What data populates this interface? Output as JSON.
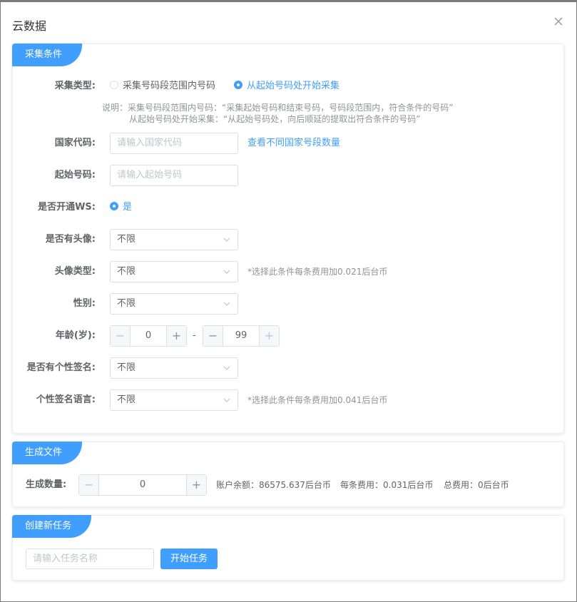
{
  "dialog": {
    "title": "云数据"
  },
  "sections": {
    "collect": {
      "tab": "采集条件"
    },
    "file": {
      "tab": "生成文件"
    },
    "task": {
      "tab": "创建新任务"
    }
  },
  "collect": {
    "type_label": "采集类型:",
    "type_options": [
      "采集号码段范围内号码",
      "从起始号码处开始采集"
    ],
    "type_selected_index": 1,
    "note_line1": "说明：采集号码段范围内号码：“采集起始号码和结束号码，号码段范围内，符合条件的号码”",
    "note_line2": "从起始号码处开始采集：“从起始号码处，向后顺延的提取出符合条件的号码”",
    "country_label": "国家代码:",
    "country_placeholder": "请输入国家代码",
    "country_link": "查看不同国家号段数量",
    "start_label": "起始号码:",
    "start_placeholder": "请输入起始号码",
    "ws_label": "是否开通WS:",
    "ws_option": "是",
    "avatar_label": "是否有头像:",
    "avatar_value": "不限",
    "avatar_type_label": "头像类型:",
    "avatar_type_value": "不限",
    "avatar_type_hint": "*选择此条件每条费用加0.021后台币",
    "gender_label": "性别:",
    "gender_value": "不限",
    "age_label": "年龄(岁):",
    "age_min": "0",
    "age_sep": "-",
    "age_max": "99",
    "sig_label": "是否有个性签名:",
    "sig_value": "不限",
    "sig_lang_label": "个性签名语言:",
    "sig_lang_value": "不限",
    "sig_lang_hint": "*选择此条件每条费用加0.041后台币"
  },
  "file": {
    "count_label": "生成数量:",
    "count_value": "0",
    "balance": "账户余额：86575.637后台币",
    "unit_cost": "每条费用：0.031后台币",
    "total_cost": "总费用：0后台币"
  },
  "task": {
    "name_placeholder": "请输入任务名称",
    "start_button": "开始任务"
  },
  "colors": {
    "accent": "#409eff",
    "border": "#dcdfe6",
    "hint": "#909399"
  }
}
